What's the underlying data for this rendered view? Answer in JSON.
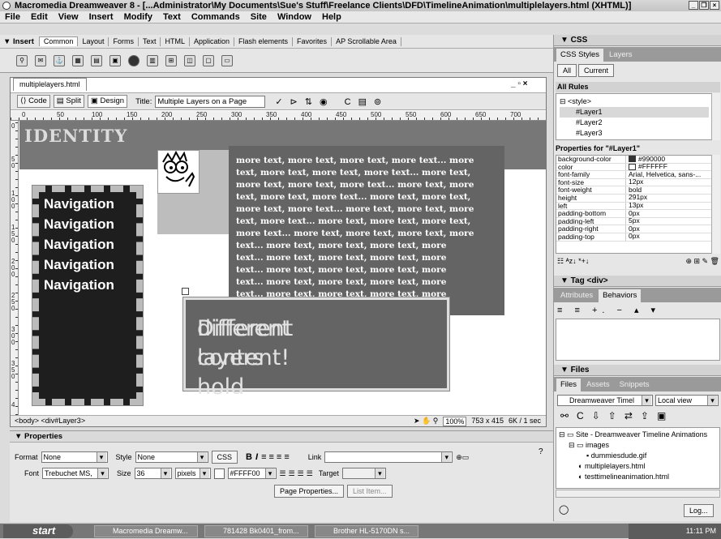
{
  "window": {
    "title": "Macromedia Dreamweaver 8 - [...Administrator\\My Documents\\Sue's Stuff\\Freelance Clients\\DFD\\TimelineAnimation\\multiplelayers.html (XHTML)]"
  },
  "menu": [
    "File",
    "Edit",
    "View",
    "Insert",
    "Modify",
    "Text",
    "Commands",
    "Site",
    "Window",
    "Help"
  ],
  "insert": {
    "title": "▼ Insert",
    "tabs": [
      "Common",
      "Layout",
      "Forms",
      "Text",
      "HTML",
      "Application",
      "Flash elements",
      "Favorites",
      "AP Scrollable Area"
    ]
  },
  "document": {
    "tab": "multiplelayers.html",
    "view_buttons": [
      "Code",
      "Split",
      "Design"
    ],
    "title_label": "Title:",
    "title_value": "Multiple Layers on a Page",
    "ruler_numbers": [
      "0",
      "50",
      "100",
      "150",
      "200",
      "250",
      "300",
      "350",
      "400",
      "450",
      "500",
      "550",
      "600",
      "650",
      "700"
    ],
    "ruler_v_numbers": [
      "0",
      "5 0",
      "1 0 0",
      "1 5 0",
      "2 0 0",
      "2 5 0",
      "3 0 0",
      "3 5 0",
      "4"
    ]
  },
  "page": {
    "identity": "IDENTITY",
    "nav_items": [
      "Navigation",
      "Navigation",
      "Navigation",
      "Navigation",
      "Navigation"
    ],
    "text_lines": [
      "more text, more text, more text, more text... more",
      "text, more text, more text, more text... more text,",
      "more text, more text, more text... more text, more",
      "text, more text, more text... more text, more text,",
      "more text, more text... more text, more text, more",
      "text, more text... more text, more text, more text,",
      "more text... more text, more text, more text, more",
      "text... more text, more text, more text, more",
      "text... more text, more text, more text, more",
      "text... more text, more text, more text, more",
      "text... more text, more text, more text, more",
      "text... more text, more text, more text, more"
    ],
    "big_text": [
      "Different layers hold",
      "different content!"
    ]
  },
  "status": {
    "tag_path": "<body> <div#Layer3>",
    "zoom": "100%",
    "size": "753 x 415",
    "download": "6K / 1 sec"
  },
  "properties": {
    "title": "▼ Properties",
    "format_label": "Format",
    "format": "None",
    "style_label": "Style",
    "style": "None",
    "css_btn": "CSS",
    "link_label": "Link",
    "font_label": "Font",
    "font": "Trebuchet MS,",
    "size_label": "Size",
    "size": "36",
    "unit": "pixels",
    "color": "#FFFF00",
    "target_label": "Target",
    "page_props": "Page Properties...",
    "list_item": "List Item..."
  },
  "css_panel": {
    "title": "▼ CSS",
    "tabs": [
      "CSS Styles",
      "Layers"
    ],
    "modes": [
      "All",
      "Current"
    ],
    "all_rules": "All Rules",
    "rules": [
      "<style>",
      "#Layer1",
      "#Layer2",
      "#Layer3"
    ],
    "props_title": "Properties for \"#Layer1\"",
    "props": [
      [
        "background-color",
        "#990000"
      ],
      [
        "color",
        "#FFFFFF"
      ],
      [
        "font-family",
        "Arial, Helvetica, sans-..."
      ],
      [
        "font-size",
        "12px"
      ],
      [
        "font-weight",
        "bold"
      ],
      [
        "height",
        "291px"
      ],
      [
        "left",
        "13px"
      ],
      [
        "padding-bottom",
        "0px"
      ],
      [
        "padding-left",
        "5px"
      ],
      [
        "padding-right",
        "0px"
      ],
      [
        "padding-top",
        "0px"
      ]
    ]
  },
  "tag_panel": {
    "title": "▼ Tag <div>",
    "tabs": [
      "Attributes",
      "Behaviors"
    ]
  },
  "files_panel": {
    "title": "▼ Files",
    "tabs": [
      "Files",
      "Assets",
      "Snippets"
    ],
    "site": "Dreamweaver Timel",
    "view": "Local view",
    "tree": [
      "Site - Dreamweaver Timeline Animations",
      "images",
      "dummiesdude.gif",
      "multiplelayers.html",
      "testtimelineanimation.html"
    ],
    "log_btn": "Log..."
  },
  "taskbar": {
    "start": "start",
    "tasks": [
      "Macromedia Dreamw...",
      "781428 Bk0401_from...",
      "Brother HL-5170DN s..."
    ],
    "time": "11:11 PM"
  }
}
